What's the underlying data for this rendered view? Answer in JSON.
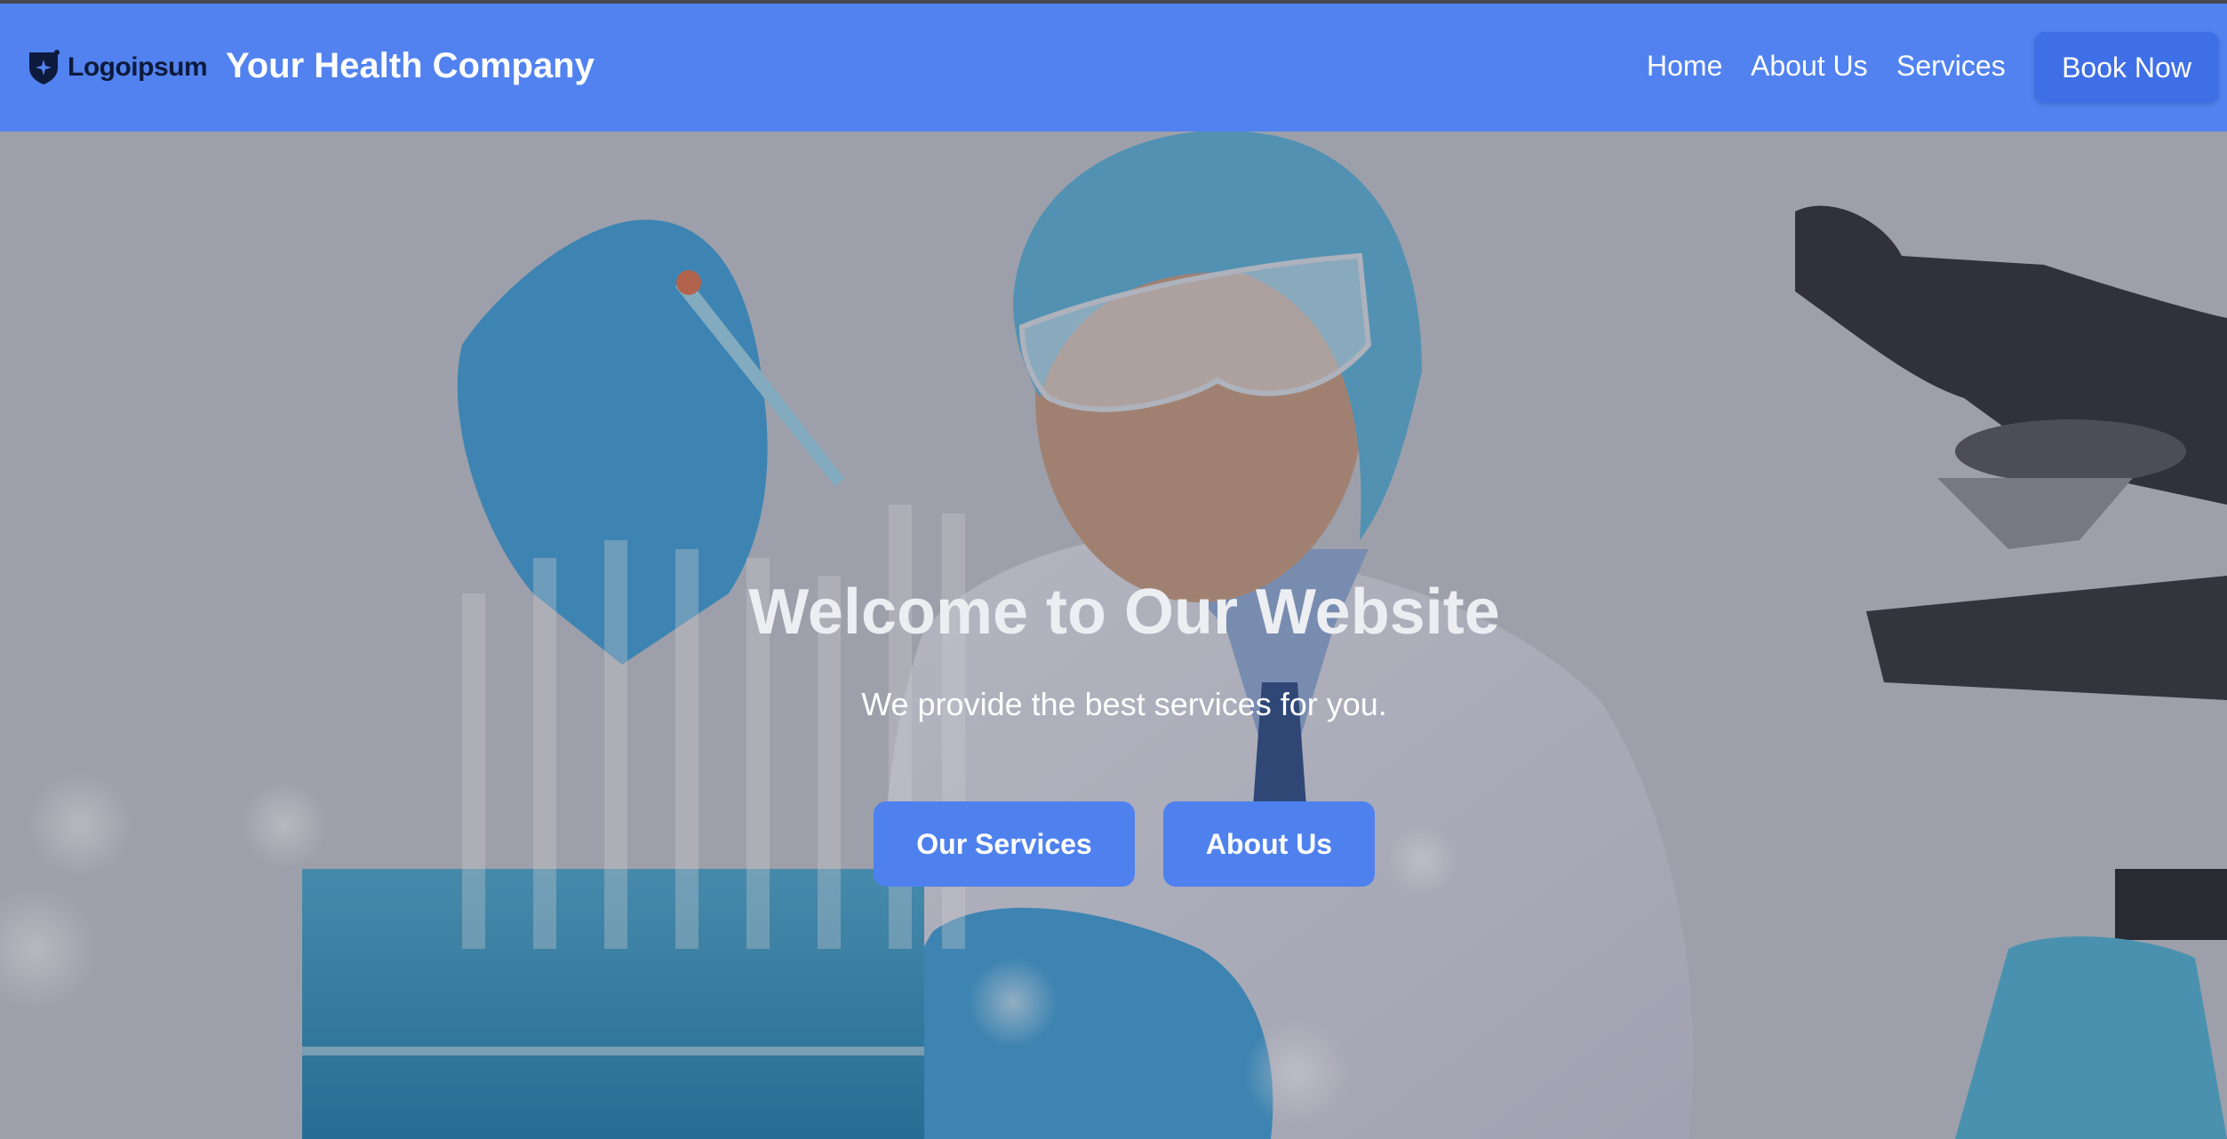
{
  "brand": {
    "logo_text": "Logoipsum",
    "site_title": "Your Health Company"
  },
  "nav": {
    "items": [
      {
        "label": "Home"
      },
      {
        "label": "About Us"
      },
      {
        "label": "Services"
      }
    ],
    "cta_label": "Book Now"
  },
  "hero": {
    "title": "Welcome to Our Website",
    "subtitle": "We provide the best services for you.",
    "buttons": [
      {
        "label": "Our Services"
      },
      {
        "label": "About Us"
      }
    ],
    "background_image": "scientist-in-lab-photo"
  },
  "colors": {
    "nav_bg": "#5182ef",
    "accent": "#4f81ee",
    "book_btn": "#3f6fe6"
  }
}
